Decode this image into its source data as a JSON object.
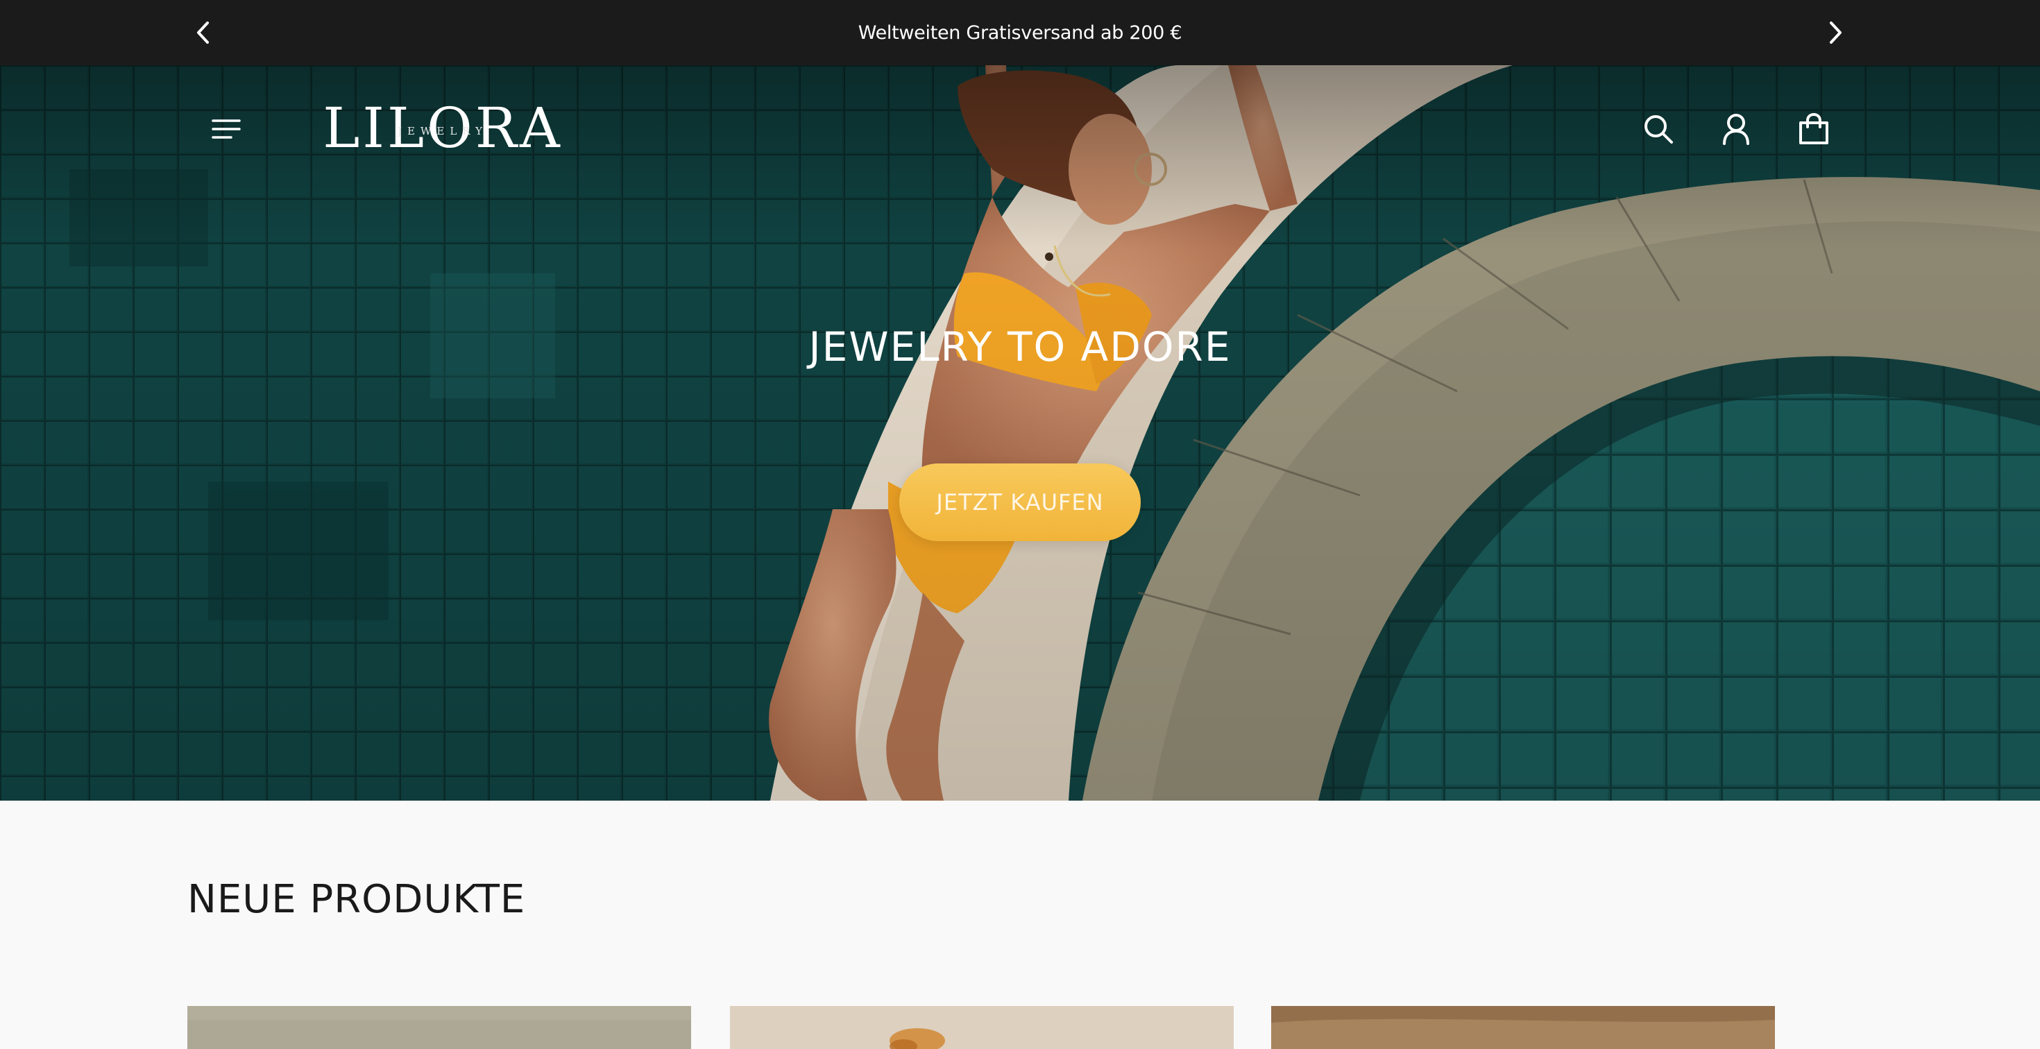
{
  "announcement": {
    "text": "Weltweiten Gratisversand ab 200 €",
    "prev_icon": "chevron-left-icon",
    "next_icon": "chevron-right-icon"
  },
  "header": {
    "logo_text": "LILORA",
    "logo_subtext": "JEWELRY",
    "menu_icon": "hamburger-menu-icon",
    "search_icon": "search-icon",
    "account_icon": "user-icon",
    "cart_icon": "shopping-bag-icon"
  },
  "hero": {
    "title": "JEWELRY TO ADORE",
    "cta_label": "JETZT KAUFEN"
  },
  "products_section": {
    "title": "NEUE PRODUKTE"
  },
  "colors": {
    "announcement_bg": "#1c1b1b",
    "cta": "#f3b842",
    "pool_teal": "#0f3d3c",
    "text_dark": "#1a1a1a"
  }
}
